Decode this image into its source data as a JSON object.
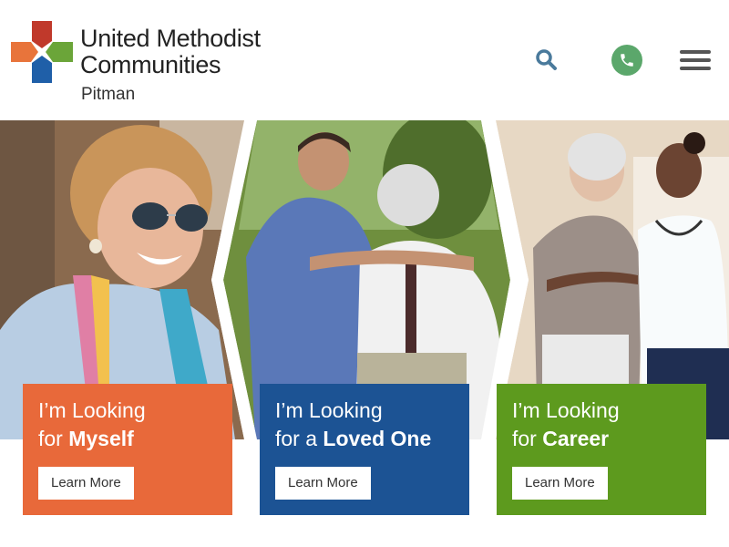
{
  "header": {
    "logo": {
      "line1": "United Methodist",
      "line2": "Communities",
      "location": "Pitman"
    },
    "icons": {
      "search": "search-icon",
      "phone": "phone-icon",
      "menu": "hamburger-menu-icon"
    }
  },
  "hero": {
    "photos": [
      "smiling-woman-sunglasses-photo",
      "man-and-elder-walking-photo",
      "nurse-helping-elder-photo"
    ]
  },
  "cards": [
    {
      "line1": "I’m Looking",
      "line2_prefix": "for ",
      "line2_bold": "Myself",
      "button": "Learn More",
      "color": "#e8693a"
    },
    {
      "line1": "I’m Looking",
      "line2_prefix": "for a ",
      "line2_bold": "Loved One",
      "button": "Learn More",
      "color": "#1c5394"
    },
    {
      "line1": "I’m Looking",
      "line2_prefix": "for ",
      "line2_bold": "Career",
      "button": "Learn More",
      "color": "#5d9a1e"
    }
  ],
  "colors": {
    "icon_blue": "#4a7a9c",
    "phone_green": "#5ba76b",
    "menu_gray": "#555555"
  }
}
